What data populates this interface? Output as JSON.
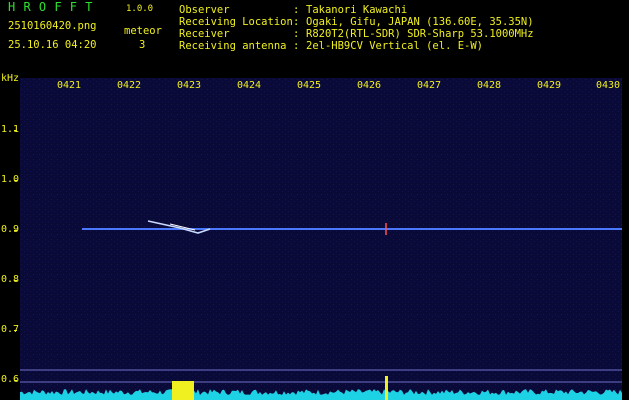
{
  "header": {
    "title": "H R O F F T",
    "version": "1.0.0",
    "filename": "2510160420.png",
    "datetime": "25.10.16 04:20",
    "meteor_label": "meteor",
    "meteor_count": "3",
    "info": [
      {
        "label": "Observer",
        "value": "Takanori Kawachi"
      },
      {
        "label": "Receiving Location",
        "value": "Ogaki, Gifu, JAPAN (136.60E, 35.35N)"
      },
      {
        "label": "Receiver",
        "value": "R820T2(RTL-SDR) SDR-Sharp 53.1000MHz"
      },
      {
        "label": "Receiving antenna",
        "value": "2el-HB9CV Vertical (el. E-W)"
      }
    ],
    "separator": ":"
  },
  "spectrogram": {
    "y_unit": "kHz",
    "y_labels": [
      "1.1",
      "1.0",
      "0.9",
      "0.8",
      "0.7",
      "0.6"
    ],
    "x_labels": [
      "0421",
      "0422",
      "0423",
      "0424",
      "0425",
      "0426",
      "0427",
      "0428",
      "0429",
      "0430"
    ],
    "colors": {
      "background": "#0a0a38",
      "trace": "#4a7cff",
      "noise": "#1ed2e6",
      "label": "#f0f020",
      "title": "#2fe02f"
    }
  }
}
